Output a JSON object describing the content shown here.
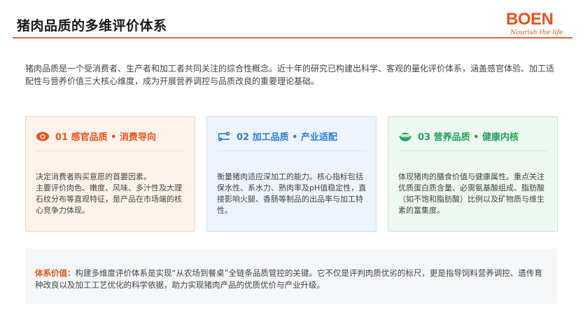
{
  "header": {
    "title": "猪肉品质的多维评价体系",
    "accent_color": "#e8603a"
  },
  "logo": {
    "word": "BOEN",
    "tagline": "Nourish the life"
  },
  "intro": "猪肉品质是一个受消费者、生产者和加工者共同关注的综合性概念。近十年的研究已构建出科学、客观的量化评价体系，涵盖感官体验、加工适配性与营养价值三大核心维度，成为开展营养调控与品质改良的重要理论基础。",
  "cards": [
    {
      "icon": "eye-icon",
      "title": "01 感官品质 • 消费导向",
      "body": "决定消费者购买意愿的首要因素。\n主要评价肉色、嫩度、风味、多汁性及大理石纹分布等直观特征，是产品在市场端的核心竞争力体现。",
      "color": "#e8541e"
    },
    {
      "icon": "process-icon",
      "title": "02 加工品质 • 产业适配",
      "body": "衡量猪肉适应深加工的能力。核心指标包括保水性、系水力、熟肉率及pH值稳定性，直接影响火腿、香肠等制品的出品率与加工特性。",
      "color": "#2f7ce0"
    },
    {
      "icon": "bowl-icon",
      "title": "03 营养品质 • 健康内核",
      "body": "体现猪肉的膳食价值与健康属性。重点关注优质蛋白质含量、必需氨基酸组成、脂肪酸（如不饱和脂肪酸）比例以及矿物质与维生素的富集度。",
      "color": "#23a55a"
    }
  ],
  "value": {
    "label": "体系价值",
    "text": "构建多维度评价体系是实现“从农场到餐桌”全链条品质管控的关键。它不仅是评判肉质优劣的标尺，更是指导饲料营养调控、遗传育种改良以及加工工艺优化的科学依据，助力实现猪肉产品的优质优价与产业升级。"
  }
}
